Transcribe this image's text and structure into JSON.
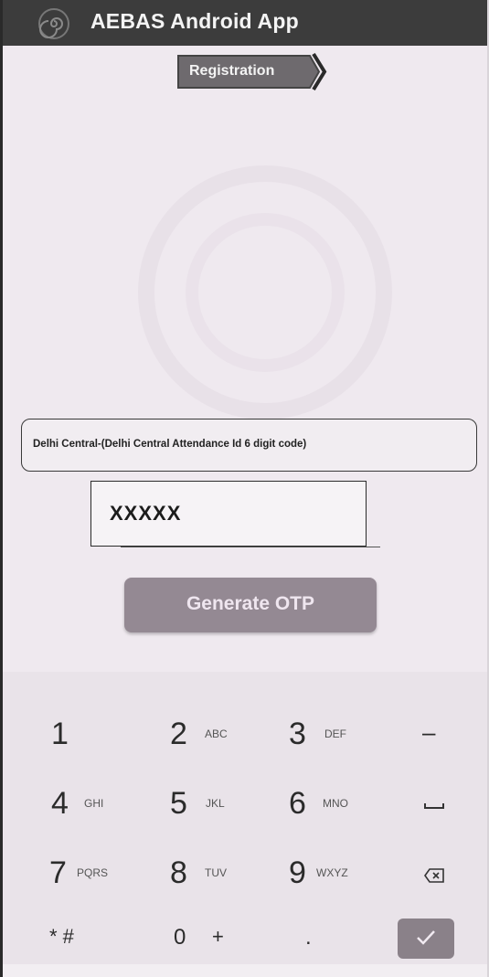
{
  "app": {
    "title": "AEBAS Android App",
    "logo_icon": "spiral-logo-icon"
  },
  "registration": {
    "label": "Registration"
  },
  "form": {
    "department": "Delhi Central-(Delhi Central Attendance Id 6 digit code)",
    "code_value": "XXXXX",
    "generate_label": "Generate OTP"
  },
  "keypad": {
    "rows": [
      [
        {
          "digit": "1",
          "letters": ""
        },
        {
          "digit": "2",
          "letters": "ABC"
        },
        {
          "digit": "3",
          "letters": "DEF"
        },
        {
          "symbol": "–",
          "name": "minus-key"
        }
      ],
      [
        {
          "digit": "4",
          "letters": "GHI"
        },
        {
          "digit": "5",
          "letters": "JKL"
        },
        {
          "digit": "6",
          "letters": "MNO"
        },
        {
          "symbol": "space",
          "name": "space-key"
        }
      ],
      [
        {
          "digit": "7",
          "letters": "PQRS"
        },
        {
          "digit": "8",
          "letters": "TUV"
        },
        {
          "digit": "9",
          "letters": "WXYZ"
        },
        {
          "symbol": "backspace",
          "name": "backspace-key"
        }
      ],
      [
        {
          "digit": "* #",
          "letters": ""
        },
        {
          "digit": "0",
          "letters": "+"
        },
        {
          "digit": ".",
          "letters": ""
        },
        {
          "symbol": "done",
          "name": "done-key"
        }
      ]
    ],
    "minus": "–",
    "star_hash": "* #",
    "zero": "0",
    "plus": "+",
    "dot": "."
  },
  "colors": {
    "appbar": "#3c3c3c",
    "registration_button": "#6e6a6e",
    "generate_button": "#948993",
    "done_key": "#8a8189"
  }
}
